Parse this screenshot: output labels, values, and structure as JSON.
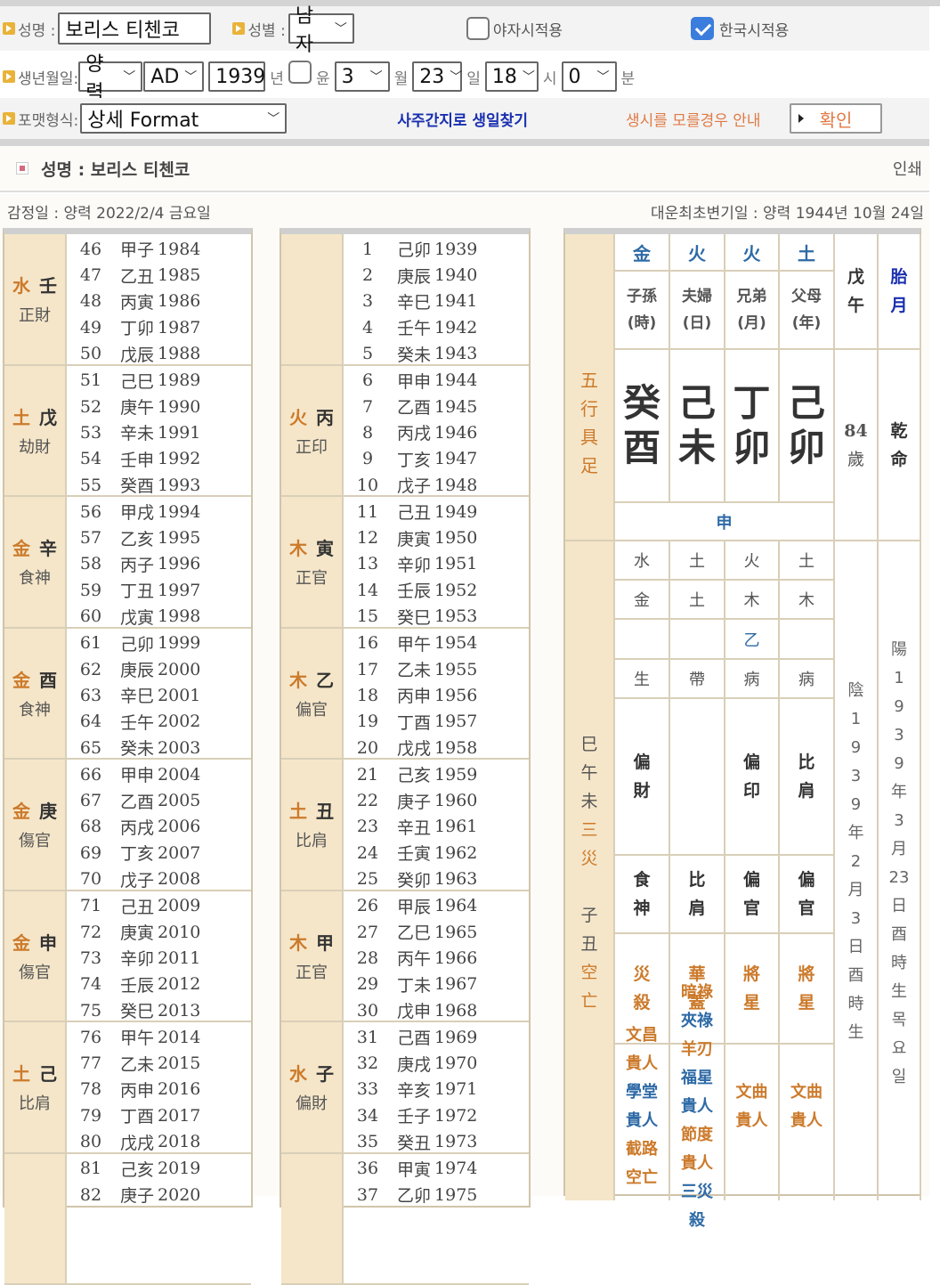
{
  "form": {
    "name_label": "성명 :",
    "name_value": "보리스 티첸코",
    "gender_label": "성별 :",
    "gender_value": "남자",
    "yaja_label": "야자시적용",
    "yaja_checked": false,
    "korea_time_label": "한국시적용",
    "korea_time_checked": true,
    "birth_label": "생년월일:",
    "calendar_value": "양력",
    "era_value": "AD",
    "year_value": "1939",
    "year_unit": "년",
    "leap_checked": false,
    "leap_label": "윤",
    "month_value": "3",
    "month_unit": "월",
    "day_value": "23",
    "day_unit": "일",
    "hour_value": "18",
    "hour_unit": "시",
    "minute_value": "0",
    "minute_unit": "분",
    "format_label": "포맷형식:",
    "format_value": "상세 Format",
    "find_by_ganji_link": "사주간지로 생일찾기",
    "unknown_time_link": "생시를 모를경우 안내",
    "confirm_button": "확인"
  },
  "result": {
    "name_line": "성명 : 보리스 티첸코",
    "print_label": "인쇄",
    "analysis_date": "감정일 : 양력 2022/2/4 금요일",
    "daeun_start": "대운최초변기일 : 양력 1944년 10월 24일"
  },
  "daeun_left": [
    {
      "element": "水",
      "stem": "壬",
      "ten_god": "正財",
      "rows": [
        [
          "46",
          "甲子",
          "1984"
        ],
        [
          "47",
          "乙丑",
          "1985"
        ],
        [
          "48",
          "丙寅",
          "1986"
        ],
        [
          "49",
          "丁卯",
          "1987"
        ],
        [
          "50",
          "戊辰",
          "1988"
        ]
      ]
    },
    {
      "element": "土",
      "stem": "戊",
      "ten_god": "劫財",
      "rows": [
        [
          "51",
          "己巳",
          "1989"
        ],
        [
          "52",
          "庚午",
          "1990"
        ],
        [
          "53",
          "辛未",
          "1991"
        ],
        [
          "54",
          "壬申",
          "1992"
        ],
        [
          "55",
          "癸酉",
          "1993"
        ]
      ]
    },
    {
      "element": "金",
      "stem": "辛",
      "ten_god": "食神",
      "rows": [
        [
          "56",
          "甲戌",
          "1994"
        ],
        [
          "57",
          "乙亥",
          "1995"
        ],
        [
          "58",
          "丙子",
          "1996"
        ],
        [
          "59",
          "丁丑",
          "1997"
        ],
        [
          "60",
          "戊寅",
          "1998"
        ]
      ]
    },
    {
      "element": "金",
      "stem": "酉",
      "ten_god": "食神",
      "rows": [
        [
          "61",
          "己卯",
          "1999"
        ],
        [
          "62",
          "庚辰",
          "2000"
        ],
        [
          "63",
          "辛巳",
          "2001"
        ],
        [
          "64",
          "壬午",
          "2002"
        ],
        [
          "65",
          "癸未",
          "2003"
        ]
      ]
    },
    {
      "element": "金",
      "stem": "庚",
      "ten_god": "傷官",
      "rows": [
        [
          "66",
          "甲申",
          "2004"
        ],
        [
          "67",
          "乙酉",
          "2005"
        ],
        [
          "68",
          "丙戌",
          "2006"
        ],
        [
          "69",
          "丁亥",
          "2007"
        ],
        [
          "70",
          "戊子",
          "2008"
        ]
      ]
    },
    {
      "element": "金",
      "stem": "申",
      "ten_god": "傷官",
      "rows": [
        [
          "71",
          "己丑",
          "2009"
        ],
        [
          "72",
          "庚寅",
          "2010"
        ],
        [
          "73",
          "辛卯",
          "2011"
        ],
        [
          "74",
          "壬辰",
          "2012"
        ],
        [
          "75",
          "癸巳",
          "2013"
        ]
      ]
    },
    {
      "element": "土",
      "stem": "己",
      "ten_god": "比肩",
      "rows": [
        [
          "76",
          "甲午",
          "2014"
        ],
        [
          "77",
          "乙未",
          "2015"
        ],
        [
          "78",
          "丙申",
          "2016"
        ],
        [
          "79",
          "丁酉",
          "2017"
        ],
        [
          "80",
          "戊戌",
          "2018"
        ]
      ]
    },
    {
      "element": "",
      "stem": "",
      "ten_god": "",
      "rows": [
        [
          "81",
          "己亥",
          "2019"
        ],
        [
          "82",
          "庚子",
          "2020"
        ]
      ]
    }
  ],
  "daeun_middle": [
    {
      "element": "",
      "stem": "",
      "ten_god": "",
      "rows": [
        [
          "1",
          "己卯",
          "1939"
        ],
        [
          "2",
          "庚辰",
          "1940"
        ],
        [
          "3",
          "辛巳",
          "1941"
        ],
        [
          "4",
          "壬午",
          "1942"
        ],
        [
          "5",
          "癸未",
          "1943"
        ]
      ]
    },
    {
      "element": "火",
      "stem": "丙",
      "ten_god": "正印",
      "rows": [
        [
          "6",
          "甲申",
          "1944"
        ],
        [
          "7",
          "乙酉",
          "1945"
        ],
        [
          "8",
          "丙戌",
          "1946"
        ],
        [
          "9",
          "丁亥",
          "1947"
        ],
        [
          "10",
          "戊子",
          "1948"
        ]
      ]
    },
    {
      "element": "木",
      "stem": "寅",
      "ten_god": "正官",
      "rows": [
        [
          "11",
          "己丑",
          "1949"
        ],
        [
          "12",
          "庚寅",
          "1950"
        ],
        [
          "13",
          "辛卯",
          "1951"
        ],
        [
          "14",
          "壬辰",
          "1952"
        ],
        [
          "15",
          "癸巳",
          "1953"
        ]
      ]
    },
    {
      "element": "木",
      "stem": "乙",
      "ten_god": "偏官",
      "rows": [
        [
          "16",
          "甲午",
          "1954"
        ],
        [
          "17",
          "乙未",
          "1955"
        ],
        [
          "18",
          "丙申",
          "1956"
        ],
        [
          "19",
          "丁酉",
          "1957"
        ],
        [
          "20",
          "戊戌",
          "1958"
        ]
      ]
    },
    {
      "element": "土",
      "stem": "丑",
      "ten_god": "比肩",
      "rows": [
        [
          "21",
          "己亥",
          "1959"
        ],
        [
          "22",
          "庚子",
          "1960"
        ],
        [
          "23",
          "辛丑",
          "1961"
        ],
        [
          "24",
          "壬寅",
          "1962"
        ],
        [
          "25",
          "癸卯",
          "1963"
        ]
      ]
    },
    {
      "element": "木",
      "stem": "甲",
      "ten_god": "正官",
      "rows": [
        [
          "26",
          "甲辰",
          "1964"
        ],
        [
          "27",
          "乙巳",
          "1965"
        ],
        [
          "28",
          "丙午",
          "1966"
        ],
        [
          "29",
          "丁未",
          "1967"
        ],
        [
          "30",
          "戊申",
          "1968"
        ]
      ]
    },
    {
      "element": "水",
      "stem": "子",
      "ten_god": "偏財",
      "rows": [
        [
          "31",
          "己酉",
          "1969"
        ],
        [
          "32",
          "庚戌",
          "1970"
        ],
        [
          "33",
          "辛亥",
          "1971"
        ],
        [
          "34",
          "壬子",
          "1972"
        ],
        [
          "35",
          "癸丑",
          "1973"
        ]
      ]
    },
    {
      "element": "",
      "stem": "",
      "ten_god": "",
      "rows": [
        [
          "36",
          "甲寅",
          "1974"
        ],
        [
          "37",
          "乙卯",
          "1975"
        ]
      ]
    }
  ],
  "saju": {
    "side_top": [
      "五",
      "行",
      "具",
      "足"
    ],
    "side_bottom": [
      [
        "巳",
        "n"
      ],
      [
        "午",
        "n"
      ],
      [
        "未",
        "n"
      ],
      [
        "三",
        "o"
      ],
      [
        "災",
        "o"
      ],
      [
        "",
        ""
      ],
      [
        "子",
        "n"
      ],
      [
        "丑",
        "n"
      ],
      [
        "空",
        "o"
      ],
      [
        "亡",
        "o"
      ]
    ],
    "pillar_elements": [
      "金",
      "火",
      "火",
      "土"
    ],
    "pillar_titles": [
      [
        "子孫",
        "(時)"
      ],
      [
        "夫婦",
        "(日)"
      ],
      [
        "兄弟",
        "(月)"
      ],
      [
        "父母",
        "(年)"
      ]
    ],
    "stems": [
      "癸",
      "己",
      "丁",
      "己"
    ],
    "branches": [
      "酉",
      "未",
      "卯",
      "卯"
    ],
    "extra_branch": "申",
    "col5_top": [
      "戊",
      "午"
    ],
    "col6_top": [
      "胎",
      "月"
    ],
    "age": "84",
    "age_unit": "歲",
    "gender_type": [
      "乾",
      "命"
    ],
    "stem_elements": [
      "水",
      "土",
      "火",
      "土"
    ],
    "branch_elements": [
      "金",
      "土",
      "木",
      "木"
    ],
    "hidden_stems": [
      "",
      "",
      "乙",
      ""
    ],
    "twelve_stages": [
      "生",
      "帶",
      "病",
      "病"
    ],
    "stem_ten_gods": [
      [
        "偏",
        "財"
      ],
      [
        "",
        ""
      ],
      [
        "偏",
        "印"
      ],
      [
        "比",
        "肩"
      ]
    ],
    "branch_ten_gods": [
      [
        "食",
        "神"
      ],
      [
        "比",
        "肩"
      ],
      [
        "偏",
        "官"
      ],
      [
        "偏",
        "官"
      ]
    ],
    "twelve_spirits": [
      [
        "災",
        "殺"
      ],
      [
        "華",
        "蓋"
      ],
      [
        "將",
        "星"
      ],
      [
        "將",
        "星"
      ]
    ],
    "special_stars": [
      [
        [
          "文昌",
          "o"
        ],
        [
          "貴人",
          "o"
        ],
        [
          "學堂",
          "b"
        ],
        [
          "貴人",
          "b"
        ],
        [
          "截路",
          "o"
        ],
        [
          "空亡",
          "o"
        ]
      ],
      [
        [
          "暗祿",
          "o"
        ],
        [
          "夾祿",
          "b"
        ],
        [
          "羊刃",
          "o"
        ],
        [
          "福星",
          "b"
        ],
        [
          "貴人",
          "b"
        ],
        [
          "節度",
          "o"
        ],
        [
          "貴人",
          "o"
        ],
        [
          "三災",
          "b"
        ],
        [
          "殺",
          "b"
        ]
      ],
      [
        [
          "文曲",
          "o"
        ],
        [
          "貴人",
          "o"
        ]
      ],
      [
        [
          "文曲",
          "o"
        ],
        [
          "貴人",
          "o"
        ]
      ]
    ],
    "lunar_date": [
      "陰",
      "1",
      "9",
      "3",
      "9",
      "年",
      "2",
      "月",
      "3",
      "日",
      "酉",
      "時",
      "生"
    ],
    "solar_date": [
      "陽",
      "1",
      "9",
      "3",
      "9",
      "年",
      "3",
      "月",
      "23",
      "日",
      "酉",
      "時",
      "生",
      "목",
      "요",
      "일"
    ]
  }
}
